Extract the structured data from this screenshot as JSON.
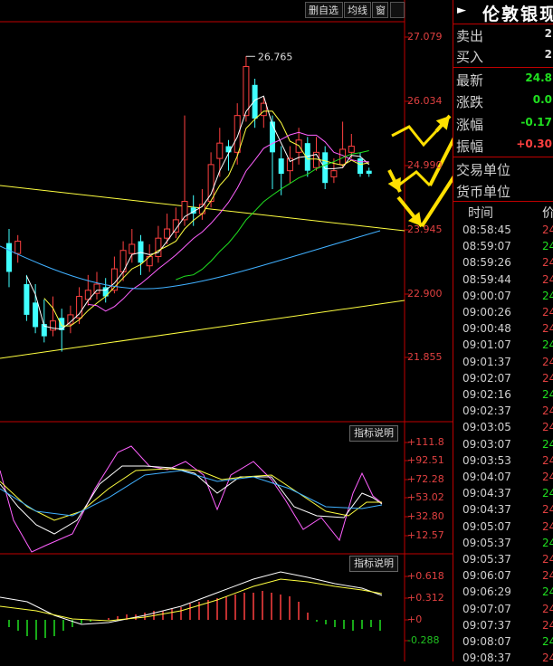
{
  "toolbar": {
    "delete_watchlist": "删自选",
    "moving_average": "均线",
    "window": "窗"
  },
  "price_axis": [
    "27.079",
    "26.034",
    "24.990",
    "23.945",
    "22.900",
    "21.855"
  ],
  "annotation_high": "26.765",
  "indicator1": {
    "label": "指标说明",
    "axis": [
      "+111.8",
      "+92.51",
      "+72.28",
      "+53.02",
      "+32.80",
      "+12.57"
    ]
  },
  "indicator2": {
    "label": "指标说明",
    "axis": [
      "+0.618",
      "+0.312",
      "+0",
      "-0.288"
    ]
  },
  "colors": {
    "up": "#ff4040",
    "down": "#40ffff",
    "ma_white": "#ffffff",
    "ma_yellow": "#ffff40",
    "ma_magenta": "#ff60ff",
    "ma_green": "#20e020",
    "ma_cyan": "#40b0ff",
    "arrow": "#ffe000",
    "green_text": "#20e020",
    "red_text": "#ff4040"
  },
  "panel": {
    "arrow_icon": "►",
    "name": "伦敦银现",
    "sell_label": "卖出",
    "sell_value": "2",
    "buy_label": "买入",
    "buy_value": "2",
    "last_label": "最新",
    "last_value": "24.8",
    "change_label": "涨跌",
    "change_value": "0.0",
    "pct_label": "涨幅",
    "pct_value": "-0.17",
    "amp_label": "振幅",
    "amp_value": "+0.30",
    "unit_label": "交易单位",
    "currency_label": "货币单位",
    "time_header": "时间",
    "price_header": "价"
  },
  "ticks": [
    {
      "time": "08:58:45",
      "price": "24"
    },
    {
      "time": "08:59:07",
      "price": "24"
    },
    {
      "time": "08:59:26",
      "price": "24"
    },
    {
      "time": "08:59:44",
      "price": "24"
    },
    {
      "time": "09:00:07",
      "price": "24"
    },
    {
      "time": "09:00:26",
      "price": "24"
    },
    {
      "time": "09:00:48",
      "price": "24"
    },
    {
      "time": "09:01:07",
      "price": "24"
    },
    {
      "time": "09:01:37",
      "price": "24"
    },
    {
      "time": "09:02:07",
      "price": "24"
    },
    {
      "time": "09:02:16",
      "price": "24"
    },
    {
      "time": "09:02:37",
      "price": "24"
    },
    {
      "time": "09:03:05",
      "price": "24"
    },
    {
      "time": "09:03:07",
      "price": "24"
    },
    {
      "time": "09:03:53",
      "price": "24"
    },
    {
      "time": "09:04:07",
      "price": "24"
    },
    {
      "time": "09:04:37",
      "price": "24"
    },
    {
      "time": "09:04:37",
      "price": "24"
    },
    {
      "time": "09:05:07",
      "price": "24"
    },
    {
      "time": "09:05:37",
      "price": "24"
    },
    {
      "time": "09:05:37",
      "price": "24"
    },
    {
      "time": "09:06:07",
      "price": "24"
    },
    {
      "time": "09:06:29",
      "price": "24"
    },
    {
      "time": "09:07:07",
      "price": "24"
    },
    {
      "time": "09:07:37",
      "price": "24"
    },
    {
      "time": "09:08:07",
      "price": "24"
    },
    {
      "time": "09:08:37",
      "price": "24"
    }
  ],
  "candles": [
    {
      "o": 23.72,
      "c": 23.25,
      "h": 23.95,
      "l": 23.0
    },
    {
      "o": 23.55,
      "c": 23.75,
      "h": 23.85,
      "l": 23.4
    },
    {
      "o": 23.05,
      "c": 22.55,
      "h": 23.2,
      "l": 22.45
    },
    {
      "o": 22.75,
      "c": 22.35,
      "h": 23.05,
      "l": 22.25
    },
    {
      "o": 22.4,
      "c": 22.2,
      "h": 22.8,
      "l": 22.1
    },
    {
      "o": 22.3,
      "c": 22.45,
      "h": 22.85,
      "l": 22.2
    },
    {
      "o": 22.5,
      "c": 22.3,
      "h": 22.65,
      "l": 21.95
    },
    {
      "o": 22.4,
      "c": 22.55,
      "h": 22.7,
      "l": 22.25
    },
    {
      "o": 22.5,
      "c": 22.85,
      "h": 23.0,
      "l": 22.4
    },
    {
      "o": 22.8,
      "c": 22.95,
      "h": 23.2,
      "l": 22.7
    },
    {
      "o": 22.9,
      "c": 23.05,
      "h": 23.25,
      "l": 22.8
    },
    {
      "o": 23.0,
      "c": 22.85,
      "h": 23.15,
      "l": 22.75
    },
    {
      "o": 22.95,
      "c": 23.3,
      "h": 23.5,
      "l": 22.9
    },
    {
      "o": 23.25,
      "c": 23.6,
      "h": 23.75,
      "l": 23.1
    },
    {
      "o": 23.55,
      "c": 23.7,
      "h": 23.95,
      "l": 23.4
    },
    {
      "o": 23.75,
      "c": 23.4,
      "h": 23.85,
      "l": 23.2
    },
    {
      "o": 23.35,
      "c": 23.5,
      "h": 23.7,
      "l": 23.25
    },
    {
      "o": 23.5,
      "c": 23.8,
      "h": 24.0,
      "l": 23.4
    },
    {
      "o": 23.8,
      "c": 23.95,
      "h": 24.2,
      "l": 23.7
    },
    {
      "o": 23.9,
      "c": 24.1,
      "h": 24.3,
      "l": 23.8
    },
    {
      "o": 24.1,
      "c": 24.4,
      "h": 25.8,
      "l": 24.0
    },
    {
      "o": 24.3,
      "c": 24.2,
      "h": 24.5,
      "l": 24.0
    },
    {
      "o": 24.2,
      "c": 24.35,
      "h": 24.6,
      "l": 24.1
    },
    {
      "o": 24.4,
      "c": 25.0,
      "h": 25.2,
      "l": 24.3
    },
    {
      "o": 25.1,
      "c": 25.35,
      "h": 25.6,
      "l": 24.8
    },
    {
      "o": 25.3,
      "c": 25.2,
      "h": 25.4,
      "l": 24.9
    },
    {
      "o": 25.2,
      "c": 25.8,
      "h": 26.0,
      "l": 25.0
    },
    {
      "o": 25.8,
      "c": 26.6,
      "h": 26.77,
      "l": 25.7
    },
    {
      "o": 26.3,
      "c": 25.75,
      "h": 26.4,
      "l": 25.6
    },
    {
      "o": 25.8,
      "c": 26.0,
      "h": 26.1,
      "l": 25.6
    },
    {
      "o": 25.7,
      "c": 25.2,
      "h": 25.8,
      "l": 24.6
    },
    {
      "o": 25.1,
      "c": 24.85,
      "h": 25.3,
      "l": 24.5
    },
    {
      "o": 24.9,
      "c": 25.1,
      "h": 25.3,
      "l": 24.7
    },
    {
      "o": 25.2,
      "c": 25.4,
      "h": 25.6,
      "l": 25.0
    },
    {
      "o": 25.35,
      "c": 24.9,
      "h": 25.45,
      "l": 24.8
    },
    {
      "o": 24.95,
      "c": 25.2,
      "h": 25.45,
      "l": 24.9
    },
    {
      "o": 25.2,
      "c": 24.7,
      "h": 25.3,
      "l": 24.6
    },
    {
      "o": 24.8,
      "c": 24.9,
      "h": 25.1,
      "l": 24.7
    },
    {
      "o": 25.0,
      "c": 25.25,
      "h": 25.7,
      "l": 24.95
    },
    {
      "o": 25.2,
      "c": 25.3,
      "h": 25.5,
      "l": 25.1
    },
    {
      "o": 25.1,
      "c": 24.85,
      "h": 25.2,
      "l": 24.8
    },
    {
      "o": 24.9,
      "c": 24.85,
      "h": 24.95,
      "l": 24.8
    }
  ]
}
